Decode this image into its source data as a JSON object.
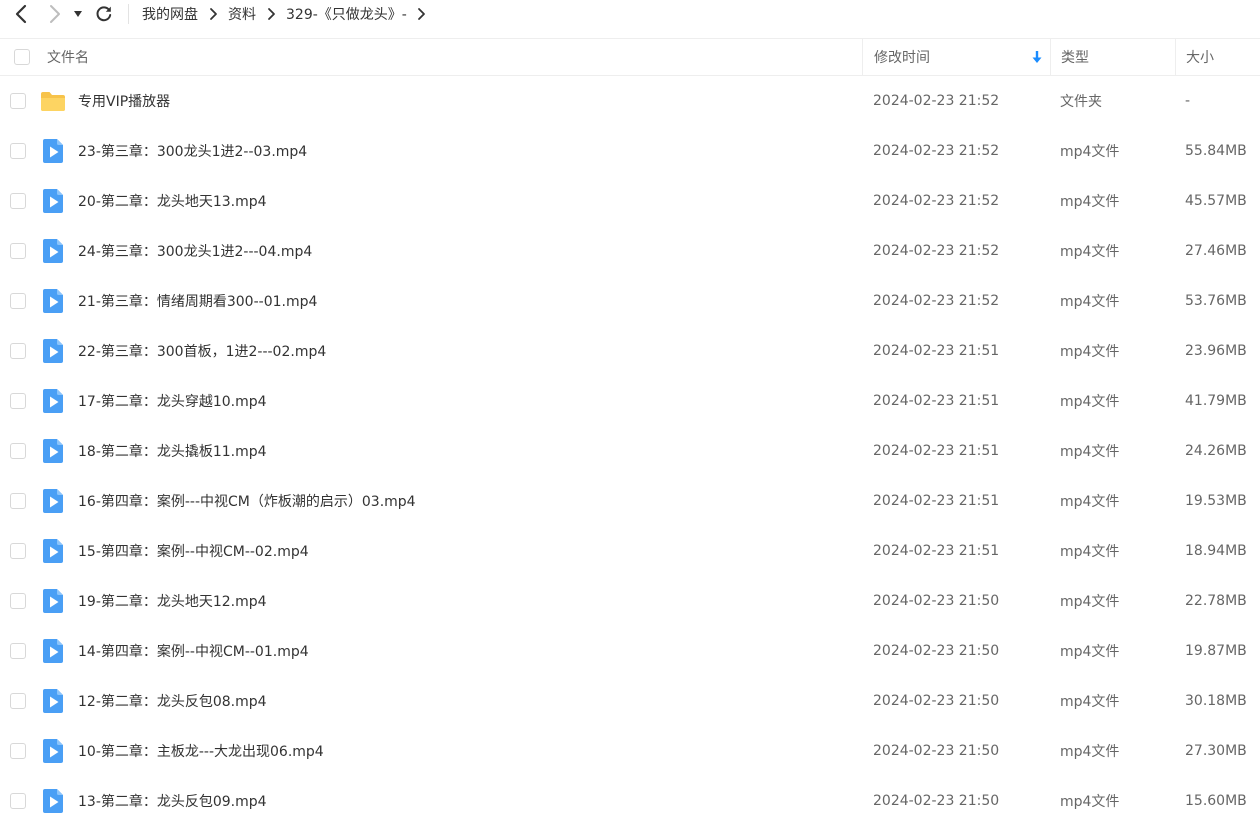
{
  "breadcrumb": [
    "我的网盘",
    "资料",
    "329-《只做龙头》-"
  ],
  "columns": {
    "name": "文件名",
    "mtime": "修改时间",
    "type": "类型",
    "size": "大小"
  },
  "colors": {
    "folder": "#f7c34a",
    "video": "#4a9ff5",
    "sort_arrow": "#1a8cff"
  },
  "icons": {
    "back": "chevron-left-icon",
    "forward": "chevron-right-icon",
    "dropdown": "caret-down-icon",
    "refresh": "refresh-icon",
    "breadcrumb_separator": "chevron-right-icon",
    "sort": "arrow-down-icon",
    "folder": "folder-icon",
    "video": "video-file-icon"
  },
  "files": [
    {
      "kind": "folder",
      "name": "专用VIP播放器",
      "mtime": "2024-02-23 21:52",
      "type": "文件夹",
      "size": "-"
    },
    {
      "kind": "video",
      "name": "23-第三章：300龙头1进2--03.mp4",
      "mtime": "2024-02-23 21:52",
      "type": "mp4文件",
      "size": "55.84MB"
    },
    {
      "kind": "video",
      "name": "20-第二章：龙头地天13.mp4",
      "mtime": "2024-02-23 21:52",
      "type": "mp4文件",
      "size": "45.57MB"
    },
    {
      "kind": "video",
      "name": "24-第三章：300龙头1进2---04.mp4",
      "mtime": "2024-02-23 21:52",
      "type": "mp4文件",
      "size": "27.46MB"
    },
    {
      "kind": "video",
      "name": "21-第三章：情绪周期看300--01.mp4",
      "mtime": "2024-02-23 21:52",
      "type": "mp4文件",
      "size": "53.76MB"
    },
    {
      "kind": "video",
      "name": "22-第三章：300首板，1进2---02.mp4",
      "mtime": "2024-02-23 21:51",
      "type": "mp4文件",
      "size": "23.96MB"
    },
    {
      "kind": "video",
      "name": "17-第二章：龙头穿越10.mp4",
      "mtime": "2024-02-23 21:51",
      "type": "mp4文件",
      "size": "41.79MB"
    },
    {
      "kind": "video",
      "name": "18-第二章：龙头撬板11.mp4",
      "mtime": "2024-02-23 21:51",
      "type": "mp4文件",
      "size": "24.26MB"
    },
    {
      "kind": "video",
      "name": "16-第四章：案例---中视CM（炸板潮的启示）03.mp4",
      "mtime": "2024-02-23 21:51",
      "type": "mp4文件",
      "size": "19.53MB"
    },
    {
      "kind": "video",
      "name": "15-第四章：案例--中视CM--02.mp4",
      "mtime": "2024-02-23 21:51",
      "type": "mp4文件",
      "size": "18.94MB"
    },
    {
      "kind": "video",
      "name": "19-第二章：龙头地天12.mp4",
      "mtime": "2024-02-23 21:50",
      "type": "mp4文件",
      "size": "22.78MB"
    },
    {
      "kind": "video",
      "name": "14-第四章：案例--中视CM--01.mp4",
      "mtime": "2024-02-23 21:50",
      "type": "mp4文件",
      "size": "19.87MB"
    },
    {
      "kind": "video",
      "name": "12-第二章：龙头反包08.mp4",
      "mtime": "2024-02-23 21:50",
      "type": "mp4文件",
      "size": "30.18MB"
    },
    {
      "kind": "video",
      "name": "10-第二章：主板龙---大龙出现06.mp4",
      "mtime": "2024-02-23 21:50",
      "type": "mp4文件",
      "size": "27.30MB"
    },
    {
      "kind": "video",
      "name": "13-第二章：龙头反包09.mp4",
      "mtime": "2024-02-23 21:50",
      "type": "mp4文件",
      "size": "15.60MB"
    }
  ]
}
